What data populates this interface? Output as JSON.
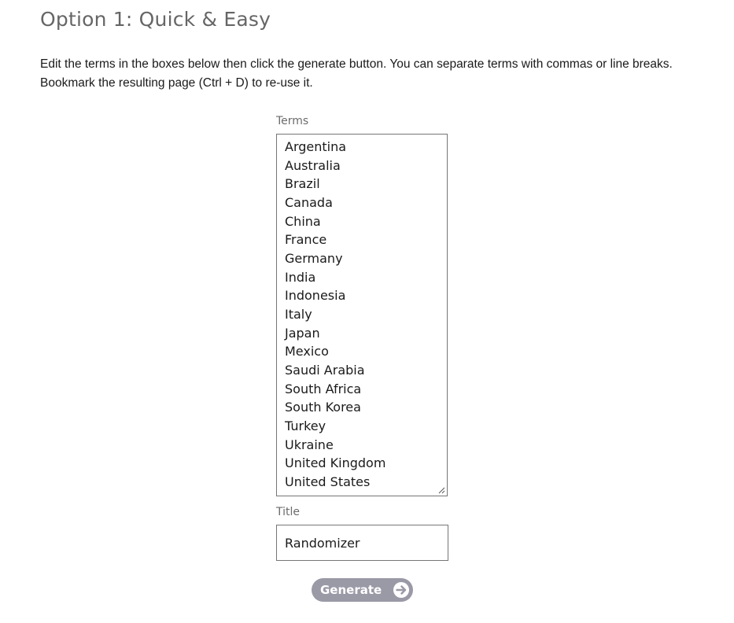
{
  "heading": "Option 1: Quick & Easy",
  "intro": {
    "line1": "Edit the terms in the boxes below then click the generate button. You can separate terms with commas or line breaks.",
    "line2": "Bookmark the resulting page (Ctrl + D) to re-use it."
  },
  "terms": {
    "label": "Terms",
    "items": [
      "Argentina",
      "Australia",
      "Brazil",
      "Canada",
      "China",
      "France",
      "Germany",
      "India",
      "Indonesia",
      "Italy",
      "Japan",
      "Mexico",
      "Saudi Arabia",
      "South Africa",
      "South Korea",
      "Turkey",
      "Ukraine",
      "United Kingdom",
      "United States"
    ]
  },
  "title": {
    "label": "Title",
    "value": "Randomizer"
  },
  "generate_button": {
    "label": "Generate",
    "icon": "arrow-right-circle-icon"
  },
  "colors": {
    "heading": "#666666",
    "button_bg": "#9a99a6",
    "field_border": "#767676"
  }
}
